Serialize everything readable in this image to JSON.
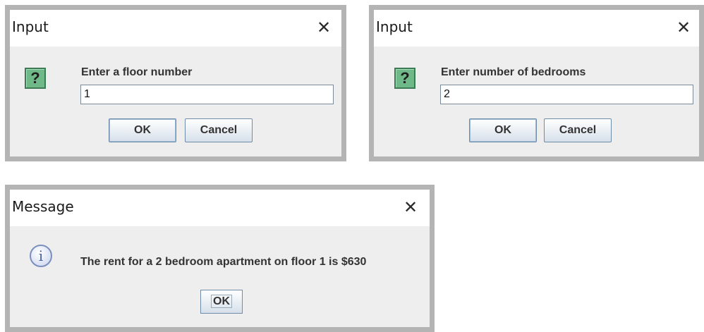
{
  "dialogs": {
    "floor": {
      "title": "Input",
      "close_glyph": "✕",
      "icon": "question-icon",
      "icon_glyph": "?",
      "prompt": "Enter a floor number",
      "value": "1",
      "ok_label": "OK",
      "cancel_label": "Cancel"
    },
    "bedrooms": {
      "title": "Input",
      "close_glyph": "✕",
      "icon": "question-icon",
      "icon_glyph": "?",
      "prompt": "Enter number of bedrooms",
      "value": "2",
      "ok_label": "OK",
      "cancel_label": "Cancel"
    },
    "message": {
      "title": "Message",
      "close_glyph": "✕",
      "icon": "info-icon",
      "icon_glyph": "i",
      "text": "The rent for a 2 bedroom apartment on floor 1 is $630",
      "ok_label": "OK"
    }
  }
}
